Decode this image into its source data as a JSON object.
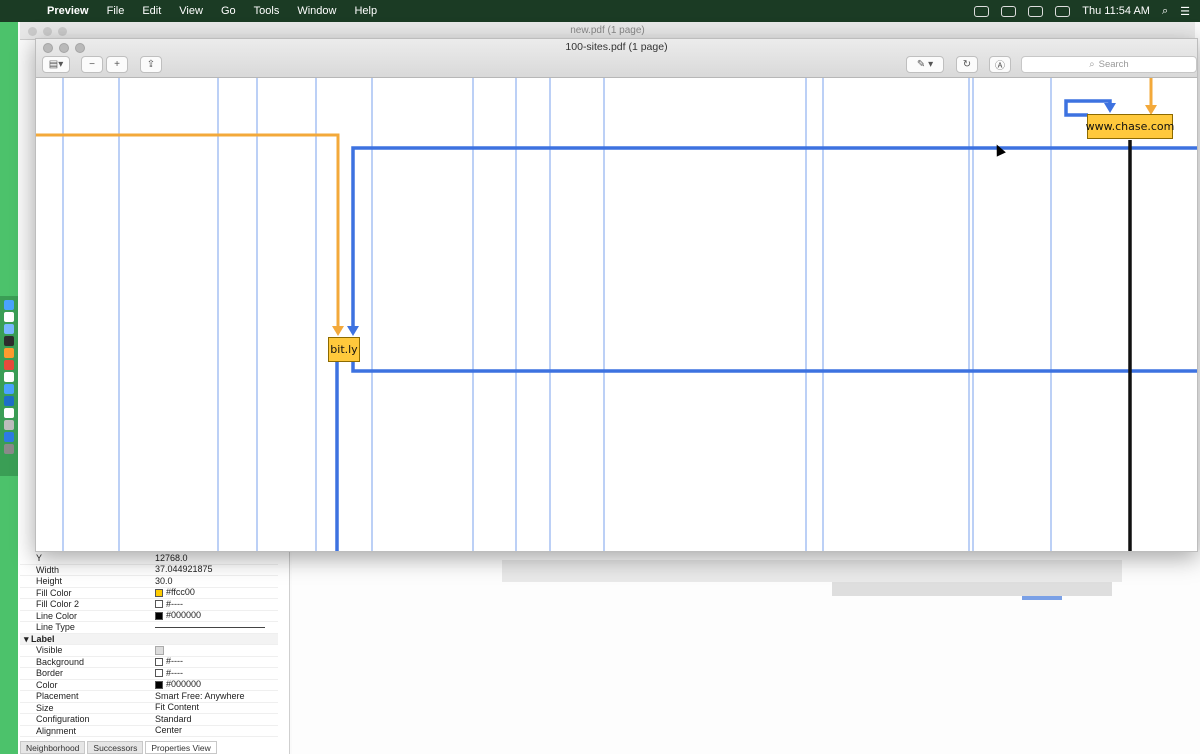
{
  "menubar": {
    "apple": "",
    "items": [
      "Preview",
      "File",
      "Edit",
      "View",
      "Go",
      "Tools",
      "Window",
      "Help"
    ],
    "clock": "Thu 11:54 AM"
  },
  "back_window": {
    "title": "new.pdf (1 page)"
  },
  "preview": {
    "title": "100-sites.pdf (1 page)",
    "search_placeholder": "Search",
    "search_icon": "magnifier-icon",
    "nodes": {
      "bitly": "bit.ly",
      "chase": "www.chase.com"
    },
    "colors": {
      "orange": "#f3a93a",
      "blue": "#3d72e0",
      "node_fill": "#ffc93c"
    }
  },
  "properties": {
    "rows": [
      {
        "k": "Y",
        "v": "12768.0"
      },
      {
        "k": "Width",
        "v": "37.044921875"
      },
      {
        "k": "Height",
        "v": "30.0"
      },
      {
        "k": "Fill Color",
        "v": "#ffcc00",
        "swatch": "#ffcc00"
      },
      {
        "k": "Fill Color 2",
        "v": "#----",
        "swatch": "none"
      },
      {
        "k": "Line Color",
        "v": "#000000",
        "swatch": "#000000"
      },
      {
        "k": "Line Type",
        "v": ""
      }
    ],
    "label_section": "Label",
    "label_rows": [
      {
        "k": "Visible",
        "v": ""
      },
      {
        "k": "Background",
        "v": "#----",
        "swatch": "none"
      },
      {
        "k": "Border",
        "v": "#----",
        "swatch": "none"
      },
      {
        "k": "Color",
        "v": "#000000",
        "swatch": "#000000"
      },
      {
        "k": "Placement",
        "v": "Smart Free: Anywhere"
      },
      {
        "k": "Size",
        "v": "Fit Content"
      },
      {
        "k": "Configuration",
        "v": "Standard"
      },
      {
        "k": "Alignment",
        "v": "Center"
      }
    ]
  },
  "bottom_tabs": [
    "Neighborhood",
    "Successors",
    "Properties View"
  ]
}
